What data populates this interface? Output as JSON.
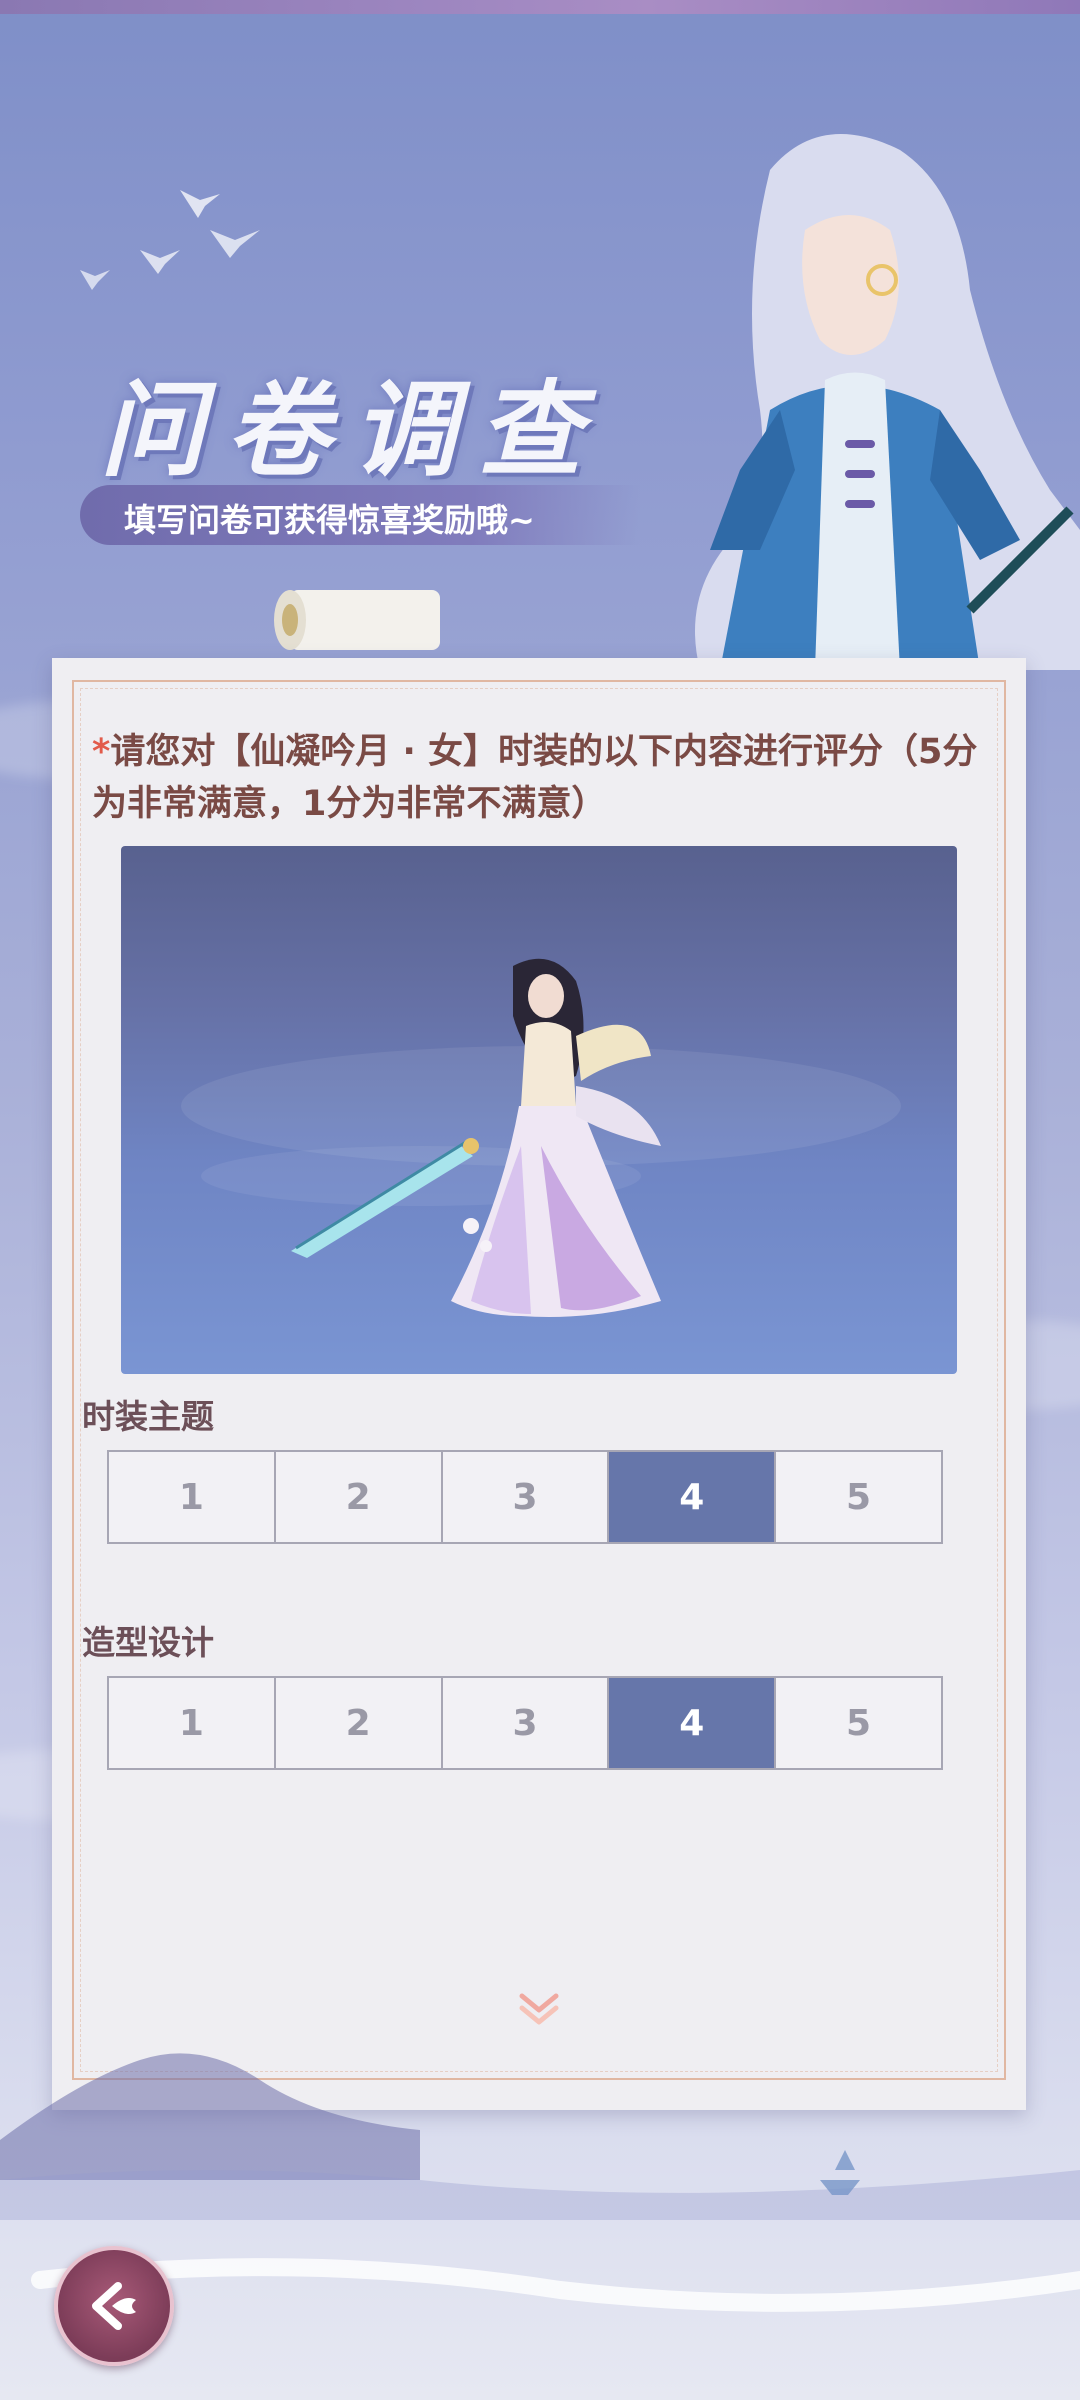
{
  "header": {
    "title": "问卷调查",
    "subtitle": "填写问卷可获得惊喜奖励哦~"
  },
  "question": {
    "required_mark": "*",
    "text": "请您对【仙凝吟月 · 女】时装的以下内容进行评分（5分为非常满意，1分为非常不满意）"
  },
  "sections": [
    {
      "label": "时装主题",
      "options": [
        "1",
        "2",
        "3",
        "4",
        "5"
      ],
      "selected": "4"
    },
    {
      "label": "造型设计",
      "options": [
        "1",
        "2",
        "3",
        "4",
        "5"
      ],
      "selected": "4"
    }
  ],
  "icons": {
    "scroll_hint": "double-chevron-down-icon",
    "back": "back-arrow-icon"
  },
  "colors": {
    "selected_option": "#6676aa",
    "question_text": "#7a4a45",
    "required_mark": "#e25b4b",
    "card_border": "#e0b7a2"
  }
}
